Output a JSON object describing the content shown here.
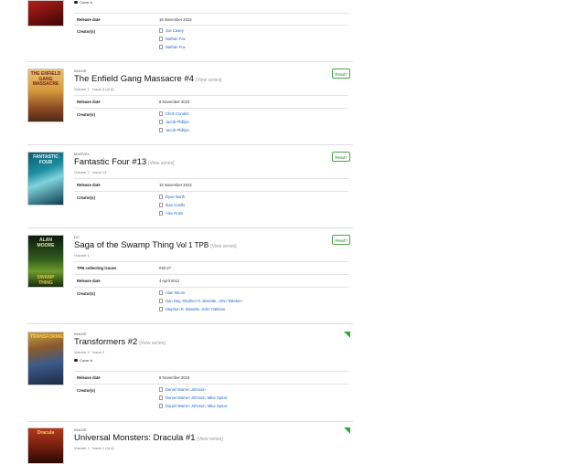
{
  "colors": {
    "link": "#1a66c9",
    "read_border": "#4aa54a",
    "corner": "#2eab2e"
  },
  "icons": {
    "credit": "document-icon",
    "variant": "speech-bubble-icon",
    "wishlist": "corner-flag-icon"
  },
  "cards": [
    {
      "publisher": "",
      "title": "",
      "subline": "",
      "variant": "Cover A",
      "read_label": "",
      "details": [
        {
          "label": "Release date",
          "value": "15 November 2023"
        }
      ],
      "creators_label": "Creator(s)",
      "creators": [
        "Joe Casey",
        "Nathan Fox",
        "Nathan Fox"
      ]
    },
    {
      "publisher": "IMAGE",
      "title": "The Enfield Gang Massacre #4",
      "view_series": "[View series]",
      "subline": "Volume 1 · Issue 4 (of 6)",
      "read_label": "Read?",
      "details": [
        {
          "label": "Release date",
          "value": "8 November 2023"
        }
      ],
      "creators_label": "Creator(s)",
      "creators": [
        "Chris Condon",
        "Jacob Phillips",
        "Jacob Phillips"
      ]
    },
    {
      "publisher": "MARVEL",
      "title": "Fantastic Four #13",
      "view_series": "[View series]",
      "subline": "Volume 7 · Issue 13",
      "read_label": "Read?",
      "details": [
        {
          "label": "Release date",
          "value": "15 November 2023"
        }
      ],
      "creators_label": "Creator(s)",
      "creators": [
        "Ryan North",
        "Iban Coello",
        "Alex Ross"
      ]
    },
    {
      "publisher": "DC",
      "title": "Saga of the Swamp Thing",
      "title_small": "Vol 1 TPB",
      "view_series": "[View series]",
      "subline": "Volume 1",
      "read_label": "Read?",
      "details": [
        {
          "label": "TPB collecting issues",
          "value": "#20-27"
        },
        {
          "label": "Release date",
          "value": "4 April 2012"
        }
      ],
      "creators_label": "Creator(s)",
      "creators": [
        "Alan Moore",
        "Dan Day, Stephen R. Bissette, John Totleben",
        "Stephen R. Bissette, John Totleben"
      ]
    },
    {
      "publisher": "IMAGE",
      "title": "Transformers #2",
      "view_series": "[View series]",
      "subline": "Volume 2 · Issue 2",
      "variant": "Cover A",
      "details": [
        {
          "label": "Release date",
          "value": "8 November 2023"
        }
      ],
      "creators_label": "Creator(s)",
      "creators": [
        "Daniel Warren Johnson",
        "Daniel Warren Johnson, Mike Spicer",
        "Daniel Warren Johnson, Mike Spicer"
      ]
    },
    {
      "publisher": "IMAGE",
      "title": "Universal Monsters: Dracula #1",
      "view_series": "[View series]",
      "subline": "Volume 1 · Issue 1 (of 4)"
    }
  ]
}
